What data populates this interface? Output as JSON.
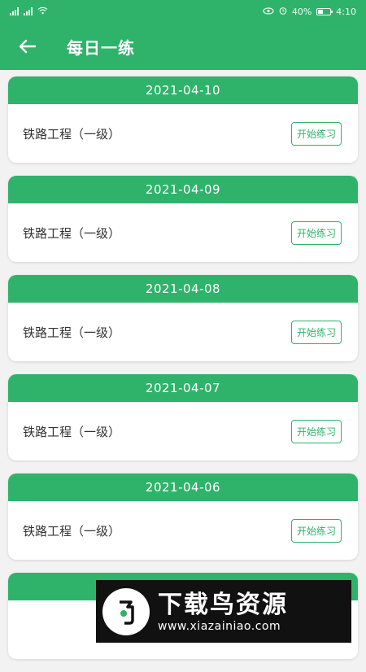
{
  "status_bar": {
    "left_text": "46 46 H+",
    "battery_percent": "40%",
    "battery_level": 0.4,
    "time": "4:10"
  },
  "app_bar": {
    "back_icon": "arrow-left-icon",
    "title": "每日一练"
  },
  "practice_list": [
    {
      "date": "2021-04-10",
      "subject": "铁路工程（一级）",
      "button": "开始练习"
    },
    {
      "date": "2021-04-09",
      "subject": "铁路工程（一级）",
      "button": "开始练习"
    },
    {
      "date": "2021-04-08",
      "subject": "铁路工程（一级）",
      "button": "开始练习"
    },
    {
      "date": "2021-04-07",
      "subject": "铁路工程（一级）",
      "button": "开始练习"
    },
    {
      "date": "2021-04-06",
      "subject": "铁路工程（一级）",
      "button": "开始练习"
    },
    {
      "date": "",
      "subject": "",
      "button": ""
    }
  ],
  "watermark": {
    "name": "下载鸟资源",
    "url": "www.xiazainiao.com"
  },
  "colors": {
    "primary": "#2fb36b",
    "background": "#f2f2f2"
  }
}
